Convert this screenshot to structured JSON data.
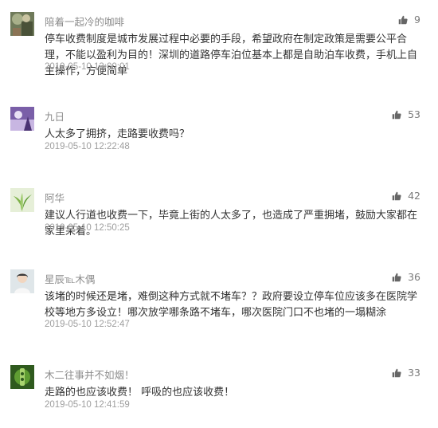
{
  "comments": [
    {
      "user": "陪着一起冷的咖啡",
      "likes": "9",
      "text": "停车收费制度是城市发展过程中必要的手段，希望政府在制定政策是需要公平合理，不能以盈利为目的！深圳的道路停车泊位基本上都是自助泊车收费，手机上自主操作，方便简单",
      "time": "2019-05-10 13:00:01",
      "avatar_icon": "avatar-coffee-icon"
    },
    {
      "user": "九日",
      "likes": "53",
      "text": "人太多了拥挤，走路要收费吗？",
      "time": "2019-05-10 12:22:48",
      "avatar_icon": "avatar-purple-icon"
    },
    {
      "user": "阿华",
      "likes": "42",
      "text": "建议人行道也收费一下，毕竟上街的人太多了，也造成了严重拥堵，鼓励大家都在家里呆着。",
      "time": "2019-05-10 12:50:25",
      "avatar_icon": "avatar-plant-icon"
    },
    {
      "user": "星辰℡木偶",
      "likes": "36",
      "text": "该堵的时候还是堵，难倒这种方式就不堵车？？政府要设立停车位应该多在医院学校等地方多设立！哪次放学哪条路不堵车，哪次医院门口不也堵的一塌糊涂",
      "time": "2019-05-10 12:52:47",
      "avatar_icon": "avatar-person-icon"
    },
    {
      "user": "木二往事并不如烟！",
      "likes": "33",
      "text": "走路的也应该收费！ 呼吸的也应该收费！",
      "time": "2019-05-10 12:41:59",
      "avatar_icon": "avatar-green-icon"
    }
  ]
}
